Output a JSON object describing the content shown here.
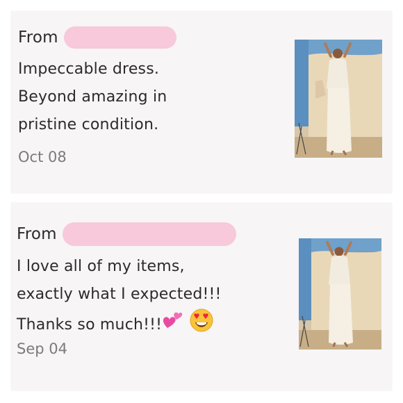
{
  "reviews": [
    {
      "from_label": "From",
      "text_lines": [
        "Impeccable dress.",
        "Beyond amazing in",
        "pristine condition."
      ],
      "date": "Oct 08",
      "photo_icon": "dress-photo"
    },
    {
      "from_label": "From",
      "text_lines": [
        "I love all of my items,",
        "exactly what I expected!!!",
        "Thanks so much!!!"
      ],
      "date": "Sep 04",
      "emojis": [
        "two-hearts-emoji",
        "heart-eyes-emoji"
      ],
      "photo_icon": "dress-photo"
    }
  ],
  "colors": {
    "redaction": "#f7c6d8",
    "card_bg": "#f7f5f6",
    "date_text": "#7b7b7b"
  }
}
